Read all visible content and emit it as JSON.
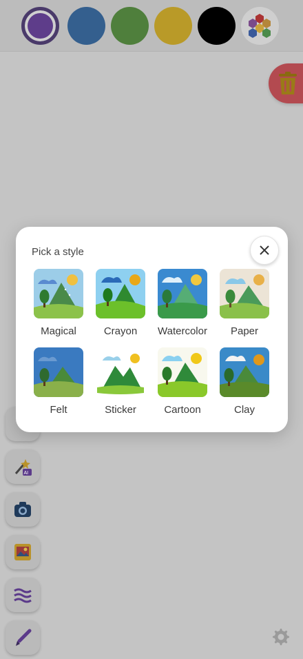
{
  "palette": {
    "colors": [
      {
        "name": "purple",
        "hex": "#5e3d8a",
        "selected": true
      },
      {
        "name": "blue",
        "hex": "#345f8e"
      },
      {
        "name": "green",
        "hex": "#4f7f3c"
      },
      {
        "name": "yellow",
        "hex": "#b99a28"
      },
      {
        "name": "black",
        "hex": "#000000"
      }
    ],
    "picker_icon": "multicolor-hex-icon"
  },
  "trash_icon": "trash-icon",
  "tools": [
    {
      "icon": "ai-magic-wand-icon"
    },
    {
      "icon": "camera-icon"
    },
    {
      "icon": "image-gallery-icon"
    },
    {
      "icon": "wavy-lines-icon"
    },
    {
      "icon": "brush-icon"
    }
  ],
  "settings_icon": "gear-icon",
  "modal": {
    "title": "Pick a style",
    "close_icon": "close-icon",
    "styles": [
      {
        "label": "Magical"
      },
      {
        "label": "Crayon"
      },
      {
        "label": "Watercolor"
      },
      {
        "label": "Paper"
      },
      {
        "label": "Felt"
      },
      {
        "label": "Sticker"
      },
      {
        "label": "Cartoon"
      },
      {
        "label": "Clay"
      }
    ]
  }
}
